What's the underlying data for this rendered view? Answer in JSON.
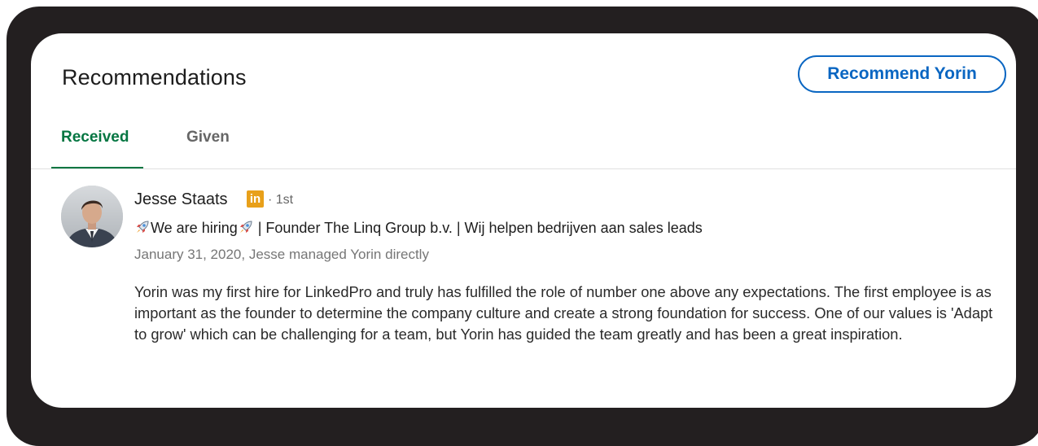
{
  "section": {
    "title": "Recommendations",
    "recommend_button": "Recommend Yorin"
  },
  "tabs": [
    {
      "label": "Received",
      "active": true
    },
    {
      "label": "Given",
      "active": false
    }
  ],
  "recommendation": {
    "name": "Jesse Staats",
    "badge": "in",
    "degree": "· 1st",
    "headline_parts": {
      "before": "We are hiring",
      "after": " | Founder The Linq Group b.v. | Wij helpen bedrijven aan sales leads"
    },
    "meta": "January 31, 2020, Jesse managed Yorin directly",
    "text": "Yorin was my first hire for LinkedPro and truly has fulfilled the role of number one above any expectations. The first employee is as important as the founder to determine the company culture and create a strong foundation for success. One of our values is 'Adapt to grow' which can be challenging for a team, but Yorin has guided the team greatly and has been a great inspiration."
  },
  "icons": {
    "headline_emoji": "rocket-icon",
    "avatar": "person-photo"
  },
  "colors": {
    "bezel": "#231f20",
    "accent_blue": "#0a66c2",
    "active_tab_green": "#057642",
    "badge_gold": "#e8a01a",
    "muted_text": "#767676"
  }
}
